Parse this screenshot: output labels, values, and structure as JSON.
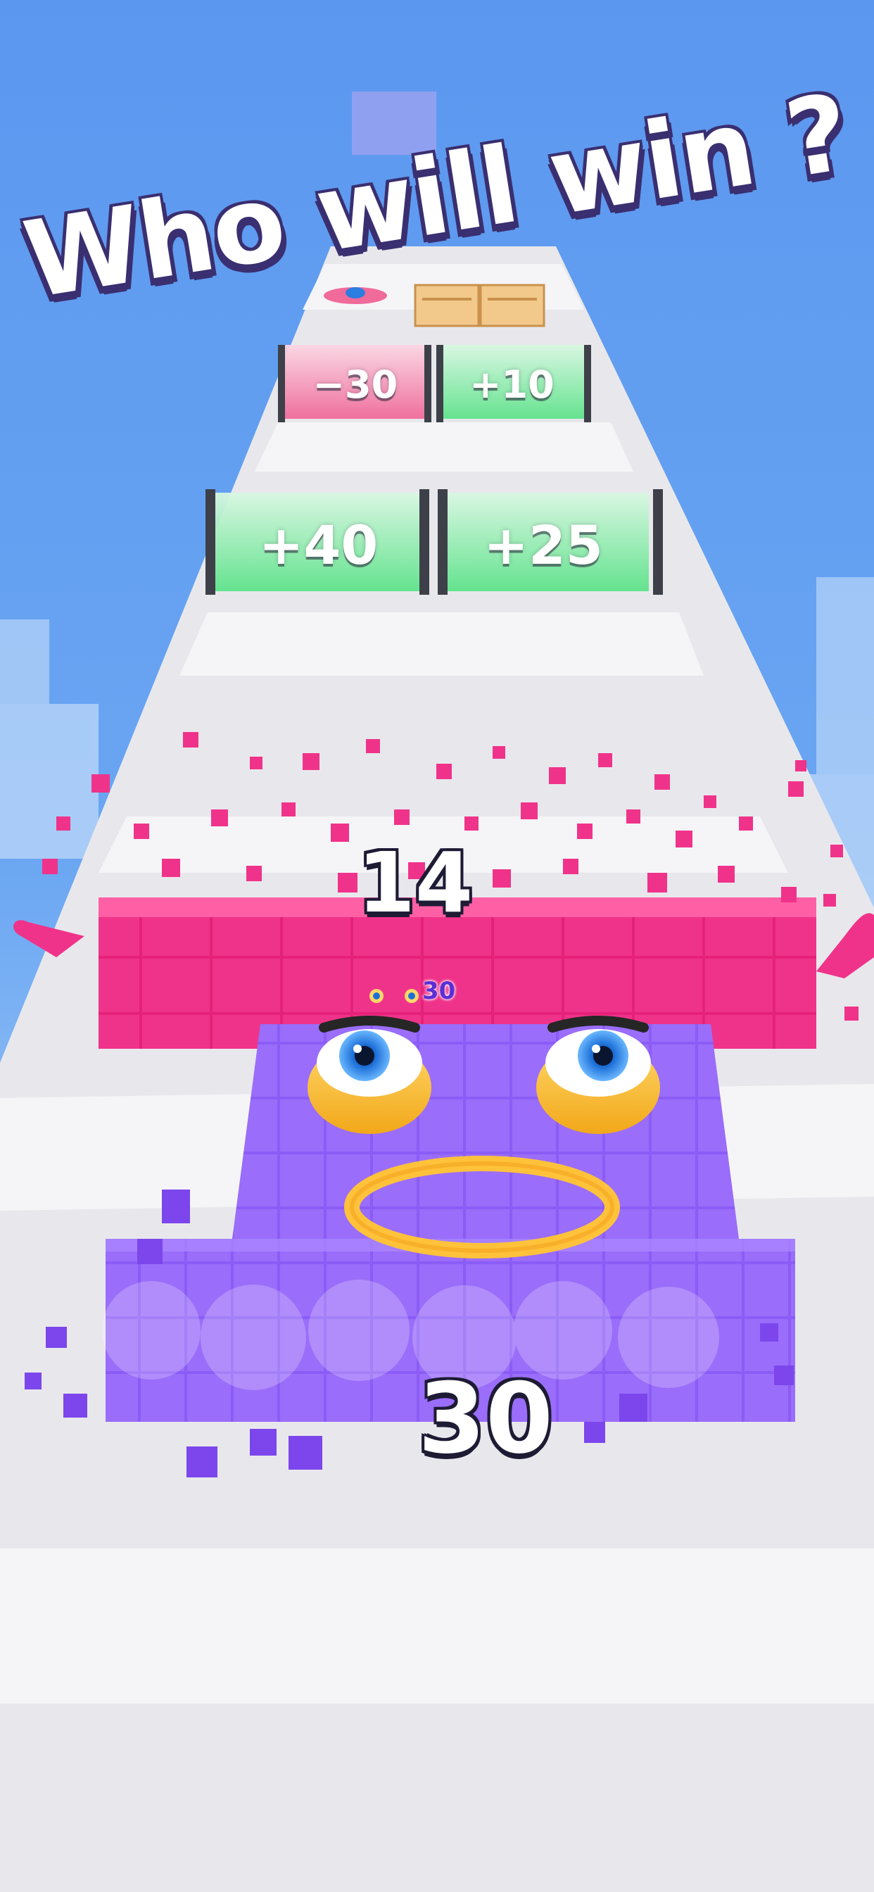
{
  "headline": "Who will win ?",
  "gates": {
    "far_left": "−30",
    "far_right": "+10",
    "near_left": "+40",
    "near_right": "+25"
  },
  "enemy": {
    "count": "14"
  },
  "player": {
    "count": "30",
    "mini_count": "30"
  },
  "colors": {
    "sky": "#5e9cf0",
    "enemy_pink": "#f0338a",
    "player_purple": "#8b5cf6",
    "gate_green": "#5ee38a",
    "gate_pink": "#f06a9a"
  }
}
